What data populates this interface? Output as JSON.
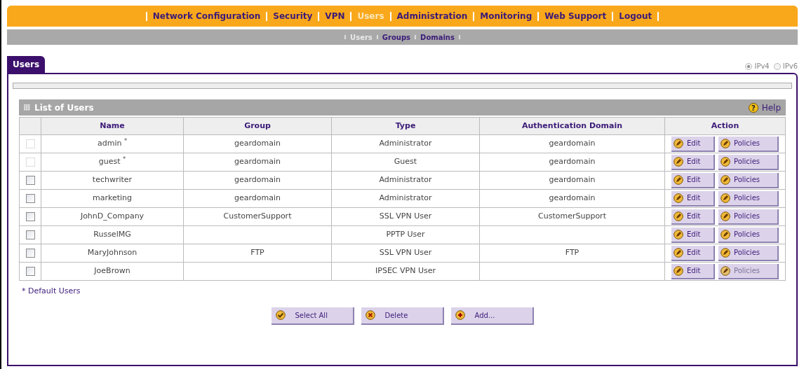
{
  "nav": {
    "items": [
      {
        "label": "Network Configuration",
        "selected": false
      },
      {
        "label": "Security",
        "selected": false
      },
      {
        "label": "VPN",
        "selected": false
      },
      {
        "label": "Users",
        "selected": true
      },
      {
        "label": "Administration",
        "selected": false
      },
      {
        "label": "Monitoring",
        "selected": false
      },
      {
        "label": "Web Support",
        "selected": false
      },
      {
        "label": "Logout",
        "selected": false
      }
    ]
  },
  "subnav": {
    "items": [
      {
        "label": "Users",
        "selected": true
      },
      {
        "label": "Groups",
        "selected": false
      },
      {
        "label": "Domains",
        "selected": false
      }
    ]
  },
  "tab": {
    "label": "Users"
  },
  "ip_versions": [
    {
      "label": "IPv4",
      "selected": true
    },
    {
      "label": "IPv6",
      "selected": false
    }
  ],
  "section": {
    "title": "List of Users",
    "help_icon": "?",
    "help": "Help"
  },
  "table": {
    "columns": [
      "Name",
      "Group",
      "Type",
      "Authentication Domain",
      "Action"
    ],
    "rows": [
      {
        "disabled": true,
        "checked": false,
        "name": "admin $^{*}$",
        "group": "geardomain",
        "type": "Administrator",
        "domain": "geardomain",
        "edit": "Edit",
        "policies": "Policies",
        "policies_disabled": false
      },
      {
        "disabled": true,
        "checked": false,
        "name": "guest $^{*}$",
        "group": "geardomain",
        "type": "Guest",
        "domain": "geardomain",
        "edit": "Edit",
        "policies": "Policies",
        "policies_disabled": false
      },
      {
        "disabled": false,
        "checked": false,
        "name": "techwriter",
        "group": "geardomain",
        "type": "Administrator",
        "domain": "geardomain",
        "edit": "Edit",
        "policies": "Policies",
        "policies_disabled": false
      },
      {
        "disabled": false,
        "checked": false,
        "name": "marketing",
        "group": "geardomain",
        "type": "Administrator",
        "domain": "geardomain",
        "edit": "Edit",
        "policies": "Policies",
        "policies_disabled": false
      },
      {
        "disabled": false,
        "checked": false,
        "name": "JohnD_Company",
        "group": "CustomerSupport",
        "type": "SSL VPN User",
        "domain": "CustomerSupport",
        "edit": "Edit",
        "policies": "Policies",
        "policies_disabled": false
      },
      {
        "disabled": false,
        "checked": false,
        "name": "RusselMG",
        "type": "PPTP User",
        "edit": "Edit",
        "policies": "Policies",
        "policies_disabled": false
      },
      {
        "disabled": false,
        "checked": false,
        "name": "MaryJohnson",
        "group": "FTP",
        "type": "SSL VPN User",
        "domain": "FTP",
        "edit": "Edit",
        "policies": "Policies",
        "policies_disabled": false
      },
      {
        "disabled": false,
        "checked": false,
        "name": "JoeBrown",
        "type": "IPSEC VPN User",
        "edit": "Edit",
        "policies": "Policies",
        "policies_disabled": true
      }
    ]
  },
  "footnote": "* Default Users",
  "buttons": [
    {
      "kind": "check",
      "label": "Select All"
    },
    {
      "kind": "cross",
      "label": "Delete"
    },
    {
      "kind": "plus",
      "label": "Add..."
    }
  ]
}
